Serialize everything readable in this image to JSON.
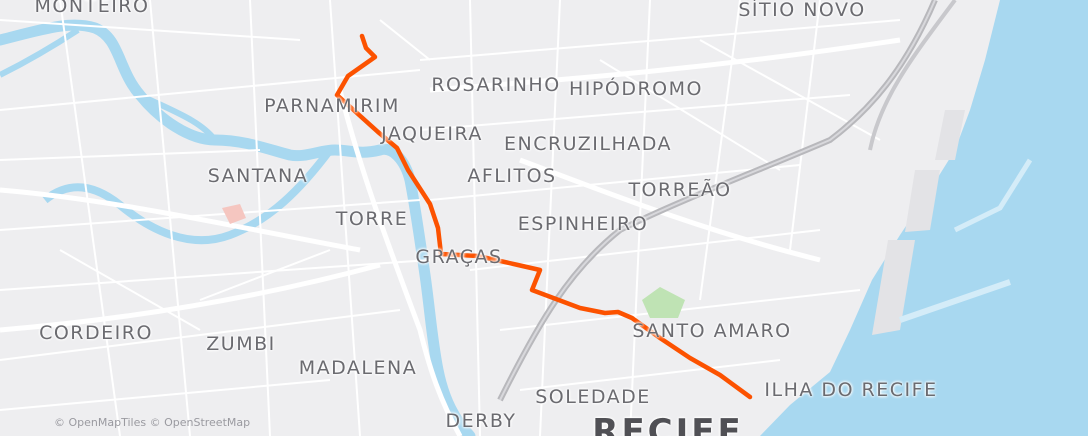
{
  "map": {
    "neighborhoods": [
      {
        "id": "monteiro",
        "label": "MONTEIRO"
      },
      {
        "id": "sitio-novo",
        "label": "SÍTIO NOVO"
      },
      {
        "id": "rosarinho",
        "label": "ROSARINHO"
      },
      {
        "id": "hipodromo",
        "label": "HIPÓDROMO"
      },
      {
        "id": "parnamirim",
        "label": "PARNAMIRIM"
      },
      {
        "id": "jaqueira",
        "label": "JAQUEIRA"
      },
      {
        "id": "encruzilhada",
        "label": "ENCRUZILHADA"
      },
      {
        "id": "santana",
        "label": "SANTANA"
      },
      {
        "id": "aflitos",
        "label": "AFLITOS"
      },
      {
        "id": "torreao",
        "label": "TORREÃO"
      },
      {
        "id": "torre",
        "label": "TORRE"
      },
      {
        "id": "espinheiro",
        "label": "ESPINHEIRO"
      },
      {
        "id": "gracas",
        "label": "GRAÇAS"
      },
      {
        "id": "cordeiro",
        "label": "CORDEIRO"
      },
      {
        "id": "zumbi",
        "label": "ZUMBI"
      },
      {
        "id": "santo-amaro",
        "label": "SANTO AMARO"
      },
      {
        "id": "madalena",
        "label": "MADALENA"
      },
      {
        "id": "ilha-do-recife",
        "label": "ILHA DO RECIFE"
      },
      {
        "id": "soledade",
        "label": "SOLEDADE"
      },
      {
        "id": "derby",
        "label": "DERBY"
      }
    ],
    "city": {
      "label": "RECIFE"
    },
    "attribution": "© OpenMapTiles © OpenStreetMap",
    "colors": {
      "route": "#fc5200",
      "water": "#a8d8f0",
      "land": "#eeeef0",
      "road": "#ffffff",
      "highway": "#b8b8bc",
      "park": "#bfe3b4",
      "poi": "#f5c6c0"
    }
  }
}
